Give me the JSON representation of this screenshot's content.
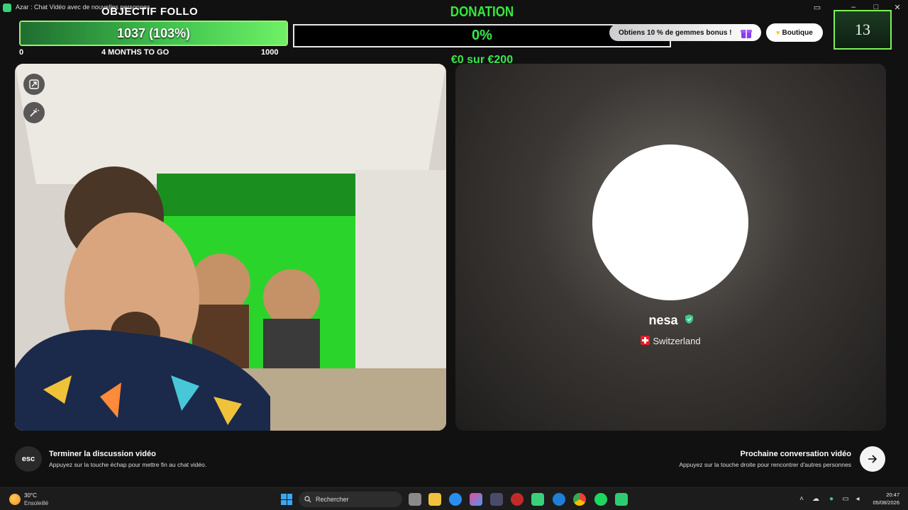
{
  "window": {
    "title": "Azar : Chat Vidéo avec de nouvelles personnes"
  },
  "goal": {
    "title": "OBJECTIF FOLLO",
    "value_label": "1037 (103%)",
    "progress": 1.0,
    "min_label": "0",
    "timeframe_label": "4 MONTHS TO GO",
    "max_label": "1000"
  },
  "donation": {
    "title": "DONATION",
    "percent_label": "0%",
    "progress": 0.0,
    "amount_label": "€0 sur €200"
  },
  "header": {
    "bonus_label": "Obtiens 10 % de gemmes bonus !",
    "shop_label": "Boutique",
    "counter_value": "13"
  },
  "partner": {
    "name": "nesa",
    "country": "Switzerland"
  },
  "bottom": {
    "esc_label": "esc",
    "end_title": "Terminer la discussion vidéo",
    "end_sub": "Appuyez sur la touche échap pour mettre fin au chat vidéo.",
    "next_title": "Prochaine conversation vidéo",
    "next_sub": "Appuyez sur la touche droite pour rencontrer d'autres personnes"
  },
  "taskbar": {
    "weather_temp": "30°C",
    "weather_desc": "Ensoleillé",
    "search_placeholder": "Rechercher",
    "time": "20:47",
    "date": "05/08/2026"
  },
  "colors": {
    "accent_green": "#3ae84a",
    "goal_border": "#9ef06c",
    "counter_border": "#7df257"
  }
}
